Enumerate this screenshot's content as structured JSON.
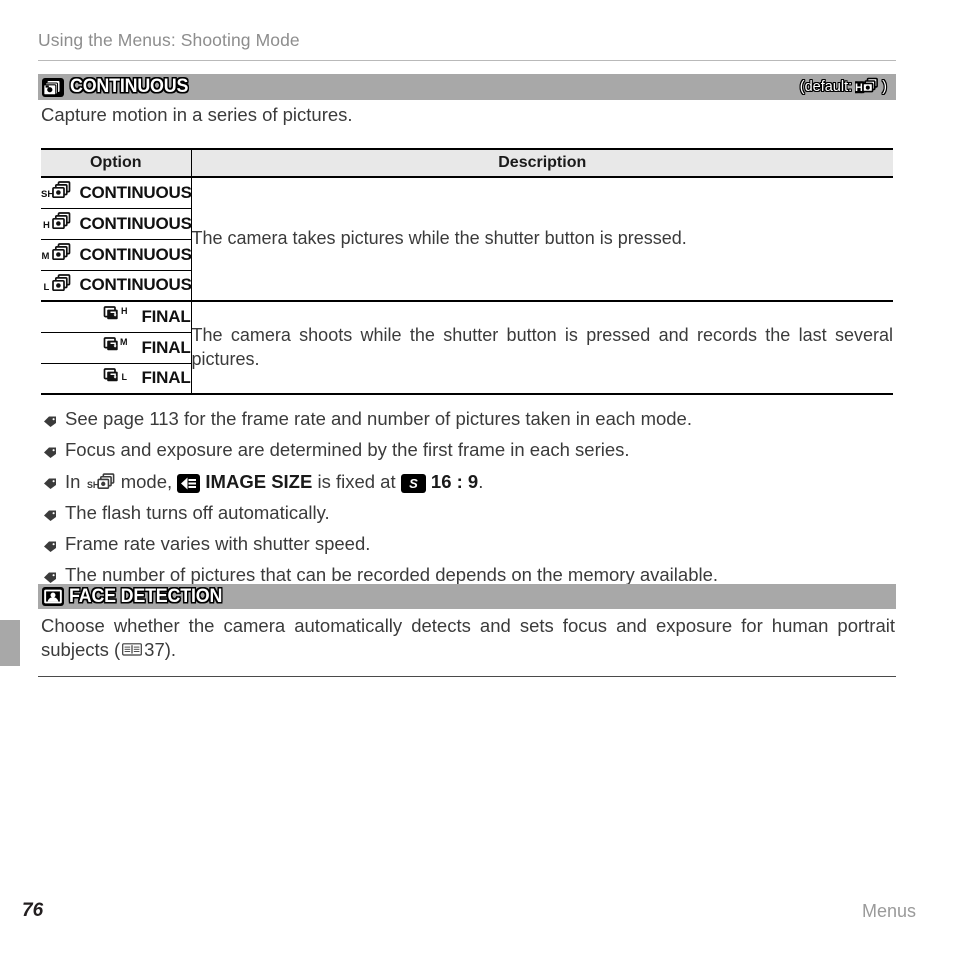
{
  "running_head": "Using the Menus: Shooting Mode",
  "sections": {
    "continuous": {
      "icon": "continuous-burst-icon",
      "title": "CONTINUOUS",
      "default_label": "(default:",
      "default_icon": "continuous-h-icon",
      "default_close": ")",
      "intro": "Capture motion in a series of pictures."
    },
    "face_detection": {
      "icon": "face-detection-icon",
      "title": "FACE DETECTION",
      "body": "Choose whether the camera automatically detects and sets focus and exposure for human portrait subjects (",
      "page_icon": "book-icon",
      "page_ref": "37",
      "body_close": ")."
    }
  },
  "table": {
    "headers": {
      "option": "Option",
      "description": "Description"
    },
    "groups": [
      {
        "description": "The camera takes pictures while the shutter button is pressed.",
        "rows": [
          {
            "icon": "burst-sh-icon",
            "badge": "SH",
            "label": "CONTINUOUS"
          },
          {
            "icon": "burst-h-icon",
            "badge": "H",
            "label": "CONTINUOUS"
          },
          {
            "icon": "burst-m-icon",
            "badge": "M",
            "label": "CONTINUOUS"
          },
          {
            "icon": "burst-l-icon",
            "badge": "L",
            "label": "CONTINUOUS"
          }
        ]
      },
      {
        "description": "The camera shoots while the shutter button is pressed and records the last several pictures.",
        "rows": [
          {
            "icon": "final-h-icon",
            "badge": "H",
            "label": "FINAL"
          },
          {
            "icon": "final-m-icon",
            "badge": "M",
            "label": "FINAL"
          },
          {
            "icon": "final-l-icon",
            "badge": "L",
            "label": "FINAL"
          }
        ]
      }
    ]
  },
  "notes": [
    {
      "bullet_icon": "diamond-bullet-icon",
      "parts": [
        {
          "t": "text",
          "v": "See page 113 for the frame rate and number of pictures taken in each mode."
        }
      ]
    },
    {
      "bullet_icon": "diamond-bullet-icon",
      "parts": [
        {
          "t": "text",
          "v": "Focus and exposure are determined by the first frame in each series."
        }
      ]
    },
    {
      "bullet_icon": "diamond-bullet-icon",
      "parts": [
        {
          "t": "text",
          "v": "In "
        },
        {
          "t": "icon",
          "v": "burst-sh-icon"
        },
        {
          "t": "text",
          "v": " mode, "
        },
        {
          "t": "icon",
          "v": "image-size-icon"
        },
        {
          "t": "bold",
          "v": " IMAGE SIZE"
        },
        {
          "t": "text",
          "v": " is fixed at "
        },
        {
          "t": "icon",
          "v": "size-s-icon"
        },
        {
          "t": "bold",
          "v": " 16 : 9"
        },
        {
          "t": "text",
          "v": "."
        }
      ]
    },
    {
      "bullet_icon": "diamond-bullet-icon",
      "parts": [
        {
          "t": "text",
          "v": "The flash turns off automatically."
        }
      ]
    },
    {
      "bullet_icon": "diamond-bullet-icon",
      "parts": [
        {
          "t": "text",
          "v": "Frame rate varies with shutter speed."
        }
      ]
    },
    {
      "bullet_icon": "diamond-bullet-icon",
      "parts": [
        {
          "t": "text",
          "v": "The number of pictures that can be recorded depends on the memory available."
        }
      ]
    }
  ],
  "footer": {
    "page_number": "76",
    "section_name": "Menus"
  },
  "colors": {
    "bar_gray": "#a8a8a8",
    "table_header_gray": "#e8e8e8",
    "body_text": "#3b3b3b",
    "muted": "#9a9a9a",
    "rule": "#b9b9b9"
  }
}
